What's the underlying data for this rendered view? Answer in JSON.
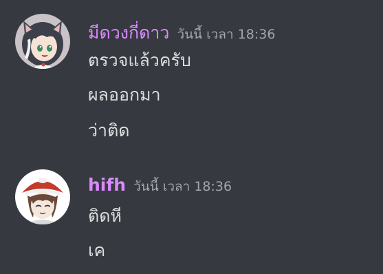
{
  "theme": {
    "background": "#36393f",
    "username_color": "#d98aff",
    "text_color": "#dcddde",
    "timestamp_color": "#a3a6aa"
  },
  "messages": [
    {
      "username": "มีดวงกี่ดาว",
      "timestamp": "วันนี้ เวลา 18:36",
      "avatar_icon": "anime-girl-avatar",
      "lines": [
        "ตรวจแล้วครับ",
        "ผลออกมา",
        "ว่าติด"
      ]
    },
    {
      "username": "hifh",
      "timestamp": "วันนี้ เวลา 18:36",
      "avatar_icon": "anime-boy-avatar",
      "lines": [
        "ติดหี",
        "เค"
      ]
    }
  ]
}
